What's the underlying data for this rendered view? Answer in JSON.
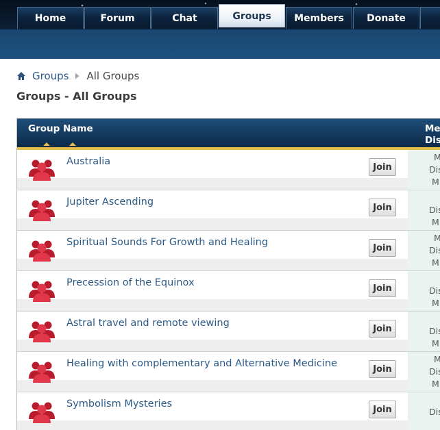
{
  "nav": {
    "tabs": [
      {
        "label": "Home",
        "active": false
      },
      {
        "label": "Forum",
        "active": false
      },
      {
        "label": "Chat",
        "active": false
      },
      {
        "label": "Groups",
        "active": true
      },
      {
        "label": "Members",
        "active": false
      },
      {
        "label": "Donate",
        "active": false
      },
      {
        "label": "",
        "active": false
      }
    ]
  },
  "breadcrumb": {
    "home_icon": "home-icon",
    "link": "Groups",
    "current": "All Groups"
  },
  "page_title": "Groups - All Groups",
  "table": {
    "header": {
      "group_name": "Group Name",
      "right_line1": "Me",
      "right_line2": "Dis"
    },
    "join_label": "Join",
    "rows": [
      {
        "name": "Australia",
        "stats": [
          "M",
          "Dis",
          "M"
        ]
      },
      {
        "name": "Jupiter Ascending",
        "stats": [
          "",
          "Dis",
          "M"
        ]
      },
      {
        "name": "Spiritual Sounds For Growth and Healing",
        "stats": [
          "M",
          "Dis",
          "M"
        ]
      },
      {
        "name": "Precession of the Equinox",
        "stats": [
          "",
          "Dis",
          "M"
        ]
      },
      {
        "name": "Astral travel and remote viewing",
        "stats": [
          "",
          "Dis",
          "M"
        ]
      },
      {
        "name": "Healing with complementary and Alternative Medicine",
        "stats": [
          "M",
          "Dis",
          "M"
        ]
      },
      {
        "name": "Symbolism Mysteries",
        "stats": [
          "",
          "Dis",
          ""
        ]
      }
    ]
  },
  "colors": {
    "nav_dark": "#0d2037",
    "link": "#2c5a86",
    "header_accent": "#e5c04a",
    "group_icon": "#d3283a"
  }
}
